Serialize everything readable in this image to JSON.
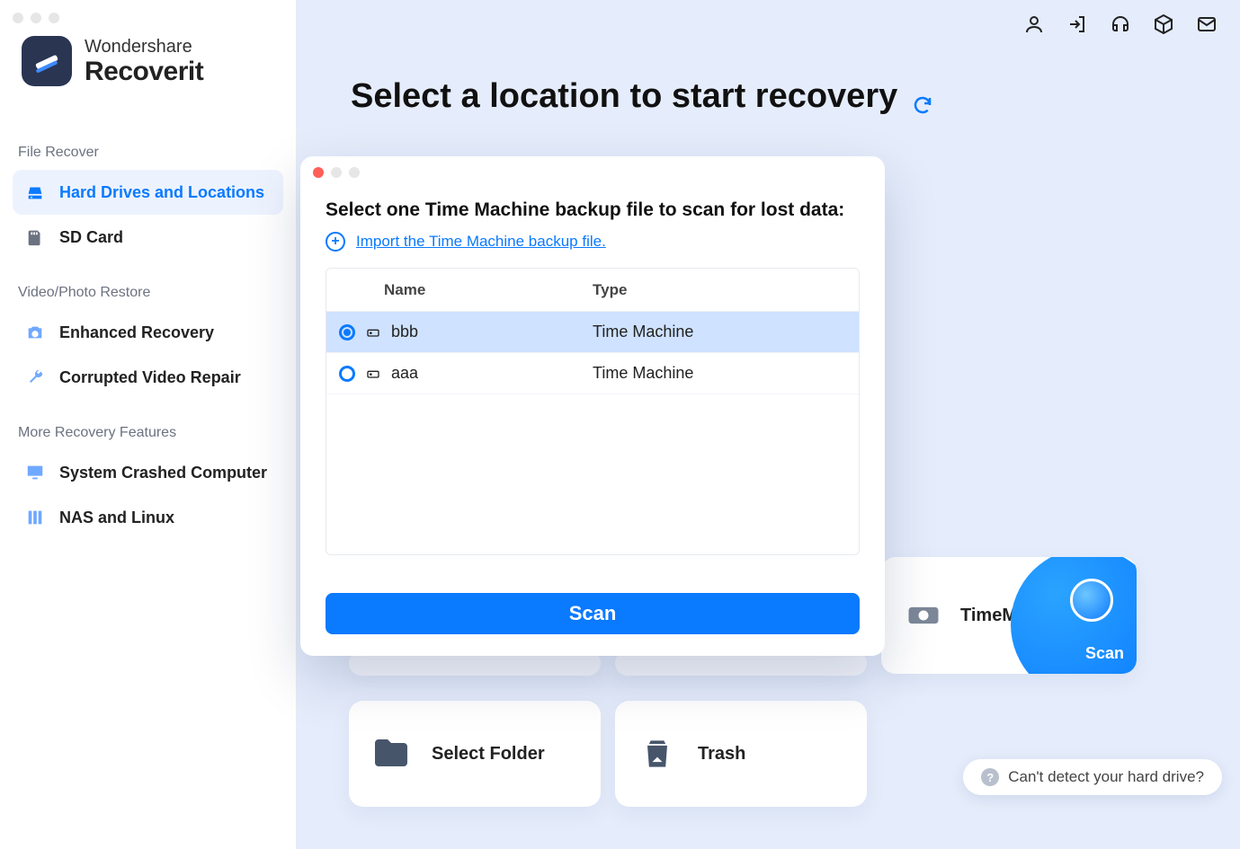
{
  "brand": {
    "top": "Wondershare",
    "bottom": "Recoverit"
  },
  "sidebar": {
    "sections": [
      {
        "title": "File Recover",
        "items": [
          {
            "label": "Hard Drives and Locations",
            "active": true,
            "name": "sidebar-hard-drives"
          },
          {
            "label": "SD Card",
            "active": false,
            "name": "sidebar-sd-card"
          }
        ]
      },
      {
        "title": "Video/Photo Restore",
        "items": [
          {
            "label": "Enhanced Recovery",
            "active": false,
            "name": "sidebar-enhanced"
          },
          {
            "label": "Corrupted Video Repair",
            "active": false,
            "name": "sidebar-corrupted"
          }
        ]
      },
      {
        "title": "More Recovery Features",
        "items": [
          {
            "label": "System Crashed Computer",
            "active": false,
            "name": "sidebar-system-crashed"
          },
          {
            "label": "NAS and Linux",
            "active": false,
            "name": "sidebar-nas-linux"
          }
        ]
      }
    ]
  },
  "main": {
    "title": "Select a location to start recovery"
  },
  "cards": {
    "folder": "Select Folder",
    "trash": "Trash",
    "timemachine": {
      "label": "TimeMachine",
      "action": "Scan"
    }
  },
  "modal": {
    "title": "Select one Time Machine backup file to scan for lost data:",
    "import_link": "Import the Time Machine backup file.",
    "columns": {
      "name": "Name",
      "type": "Type"
    },
    "rows": [
      {
        "name": "bbb",
        "type": "Time Machine",
        "selected": true
      },
      {
        "name": "aaa",
        "type": "Time Machine",
        "selected": false
      }
    ],
    "scan_label": "Scan"
  },
  "help": {
    "text": "Can't detect your hard drive?"
  }
}
